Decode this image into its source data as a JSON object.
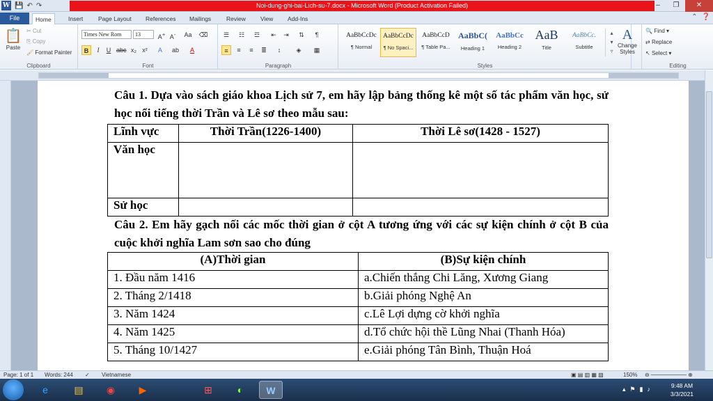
{
  "window": {
    "title": "Noi-dung-ghi-bai-Lich-su-7.docx  -  Microsoft Word (Product Activation Failed)",
    "minimize": "–",
    "maximize": "❐",
    "close": "✕"
  },
  "ribbon_tabs": {
    "file": "File",
    "tabs": [
      "Home",
      "Insert",
      "Page Layout",
      "References",
      "Mailings",
      "Review",
      "View",
      "Add-Ins"
    ]
  },
  "clipboard": {
    "paste": "Paste",
    "cut": "Cut",
    "copy": "Copy",
    "format_painter": "Format Painter",
    "label": "Clipboard"
  },
  "font": {
    "name": "Times New Rom",
    "size": "13",
    "label": "Font"
  },
  "paragraph": {
    "label": "Paragraph"
  },
  "styles": {
    "items": [
      {
        "preview": "AaBbCcDc",
        "name": "¶ Normal"
      },
      {
        "preview": "AaBbCcDc",
        "name": "¶ No Spaci..."
      },
      {
        "preview": "AaBbCcD",
        "name": "¶ Table Pa..."
      },
      {
        "preview": "AaBbC(",
        "name": "Heading 1"
      },
      {
        "preview": "AaBbCc",
        "name": "Heading 2"
      },
      {
        "preview": "AaB",
        "name": "Title"
      },
      {
        "preview": "AaBbCc.",
        "name": "Subtitle"
      }
    ],
    "change": "Change Styles",
    "label": "Styles"
  },
  "editing": {
    "find": "Find",
    "replace": "Replace",
    "select": "Select",
    "label": "Editing"
  },
  "document": {
    "q1": "Câu 1. Dựa vào sách giáo khoa Lịch sử 7, em hãy lập bảng thống kê một số tác phẩm văn học, sử học nổi tiếng thời Trần và Lê sơ theo mẫu sau:",
    "table1": {
      "headers": [
        "Lĩnh vực",
        "Thời Trần(1226-1400)",
        "Thời Lê sơ(1428 - 1527)"
      ],
      "rows": [
        "Văn học",
        "Sử học"
      ]
    },
    "q2": "Câu 2. Em hãy  gạch nối các mốc thời gian ở cột A tương ứng với các sự kiện chính ở cột B của cuộc khởi nghĩa Lam sơn sao cho đúng",
    "table2": {
      "headers": [
        "(A)Thời gian",
        "(B)Sự kiện chính"
      ],
      "rows": [
        [
          "1. Đầu năm 1416",
          "a.Chiến thắng Chi Lăng, Xương Giang"
        ],
        [
          "2. Tháng 2/1418",
          "b.Giải phóng Nghệ An"
        ],
        [
          "3. Năm 1424",
          "c.Lê Lợi dựng cờ khởi nghĩa"
        ],
        [
          "4. Năm 1425",
          "d.Tổ chức hội thề Lũng Nhai (Thanh Hóa)"
        ],
        [
          "5. Tháng 10/1427",
          "e.Giải phóng Tân Bình, Thuận Hoá"
        ]
      ]
    }
  },
  "status": {
    "page": "Page: 1 of 1",
    "words": "Words: 244",
    "language": "Vietnamese",
    "zoom": "150%"
  },
  "taskbar": {
    "time": "9:48 AM",
    "date": "3/3/2021"
  }
}
